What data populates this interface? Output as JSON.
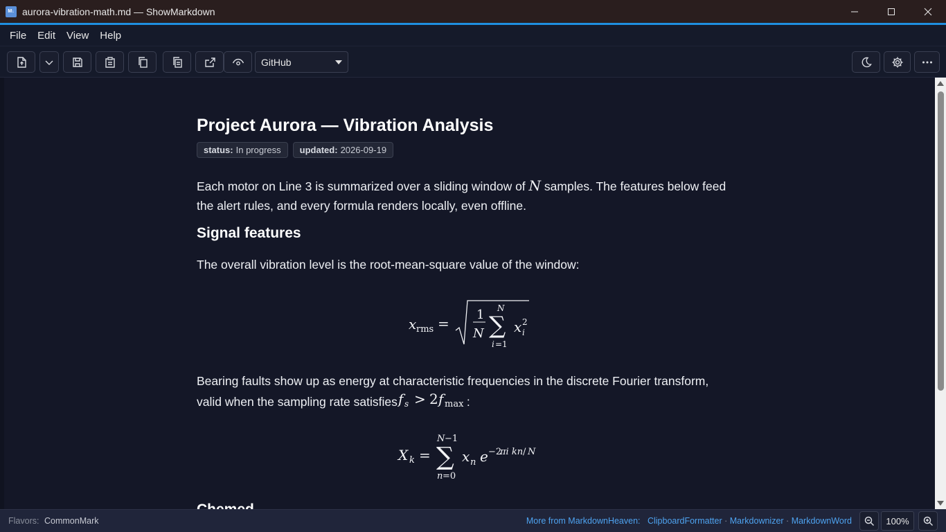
{
  "window": {
    "title": "aurora-vibration-math.md — ShowMarkdown",
    "app_icon_label": "M↓",
    "accent_color": "#1f8fe0"
  },
  "menu": [
    "File",
    "Edit",
    "View",
    "Help"
  ],
  "toolbar": {
    "buttons": [
      "new-file-icon",
      "chevron-down-icon",
      "save-icon",
      "paste-icon",
      "copy-icon",
      "copy-formatted-icon",
      "export-icon",
      "preview-eye-icon",
      "theme-moon-icon",
      "gear-icon",
      "more-icon"
    ],
    "style_select": "GitHub"
  },
  "document": {
    "title": "Project Aurora — Vibration Analysis",
    "badges": [
      {
        "key": "status:",
        "value": "In progress"
      },
      {
        "key": "updated:",
        "value": "2026-09-19"
      }
    ],
    "intro_a": "Each motor on Line 3 is summarized over a sliding window of ",
    "intro_var": "N",
    "intro_b": " samples. The features below feed",
    "intro_line2": "the alert rules, and every formula renders locally, even offline.",
    "section_heading": "Signal features",
    "rms_intro": "The overall vibration level is the root-mean-square value of the window:",
    "dft_line1": "Bearing faults show up as energy at characteristic frequencies in the discrete Fourier transform,",
    "dft_line2_a": "valid when the sampling rate satisfies ",
    "dft_line2_end": ":",
    "next_heading_partial": "Chemed"
  },
  "statusbar": {
    "flavors_label": "Flavors:",
    "flavors_value": "CommonMark",
    "more_label": "More from MarkdownHeaven:",
    "links": [
      "ClipboardFormatter",
      "Markdownizer",
      "MarkdownWord"
    ],
    "separator": " · ",
    "zoom": "100%"
  }
}
